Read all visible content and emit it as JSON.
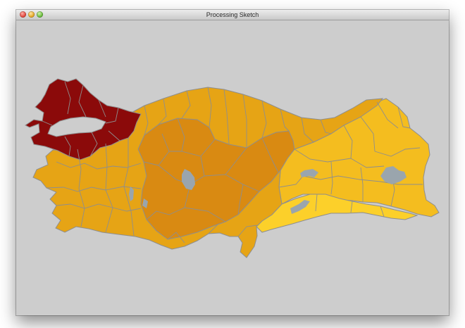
{
  "window": {
    "title": "Processing Sketch"
  },
  "colors": {
    "background": "#cdcdcd",
    "marmara": "#8b0a0a",
    "central": "#d98a12",
    "black_sea_aegean": "#e6a415",
    "east": "#f4bd1f",
    "southeast": "#fcd02a",
    "lakes": "#9aa5ad",
    "borders": "#8e8e8e"
  }
}
